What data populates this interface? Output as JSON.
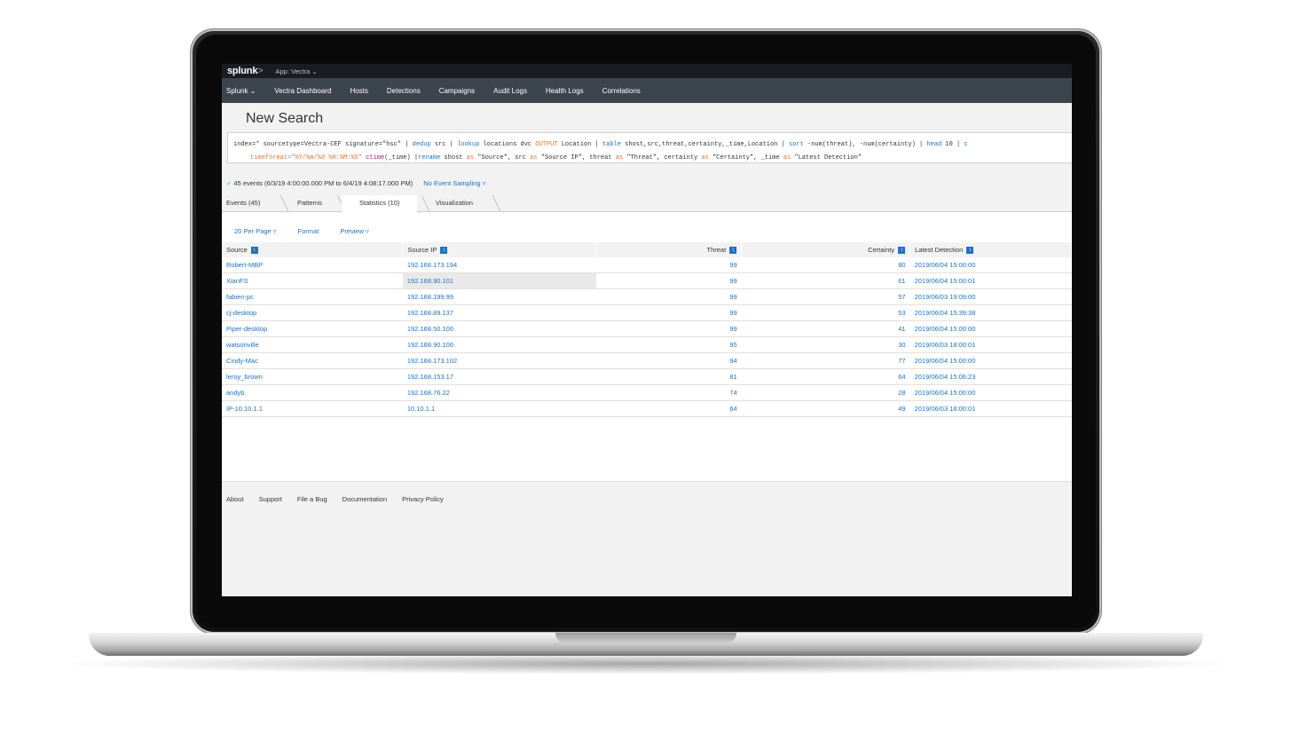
{
  "app": {
    "logo": "splunk",
    "logo_suffix": ">",
    "app_name": "App: Vectra ⌄"
  },
  "nav": {
    "items": [
      "Splunk ⌄",
      "Vectra Dashboard",
      "Hosts",
      "Detections",
      "Campaigns",
      "Audit Logs",
      "Health Logs",
      "Correlations"
    ]
  },
  "search": {
    "title": "New Search",
    "q1_a": "index=* sourcetype=Vectra-CEF signature=\"hsc\"  | ",
    "q1_dedup": "dedup",
    "q1_b": " src | ",
    "q1_lookup": "lookup",
    "q1_c": " locations dvc ",
    "q1_output": "OUTPUT",
    "q1_d": " Location | ",
    "q1_table": "table",
    "q1_e": " shost,src,threat,certainty,_time,Location | ",
    "q1_sort": "sort",
    "q1_f": " -num(threat), -num(certainty) | ",
    "q1_head": "head",
    "q1_g": " 10 | ",
    "q1_cut": "c",
    "q2_a": "timeformat=\"%Y/%m/%d %H:%M:%S\" ",
    "q2_ctime": "ctime",
    "q2_b": "(_time) |",
    "q2_rename": "rename",
    "q2_c": " shost ",
    "q2_as1": "as",
    "q2_d": " \"Source\", src ",
    "q2_as2": "as",
    "q2_e": " \"Source IP\", threat ",
    "q2_as3": "as",
    "q2_f": " \"Threat\", certainty ",
    "q2_as4": "as",
    "q2_g": " \"Certainty\", _time ",
    "q2_as5": "as",
    "q2_h": " \"Latest Detection\""
  },
  "status": {
    "check": "✓",
    "events": "45 events (6/3/19 4:00:00.000 PM to 6/4/19 4:08:17.000 PM)",
    "sampling": "No Event Sampling ▿"
  },
  "tabs": [
    "Events (45)",
    "Patterns",
    "Statistics (10)",
    "Visualization"
  ],
  "toolbar": {
    "per_page": "20 Per Page ▿",
    "format": "Format",
    "preview": "Preview ▿"
  },
  "table": {
    "headers": [
      "Source",
      "Source IP",
      "Threat",
      "Certainty",
      "Latest Detection"
    ],
    "sort_icon": "↕",
    "rows": [
      [
        "Robert-MBP",
        "192.168.173.194",
        "99",
        "80",
        "2019/06/04 15:00:00"
      ],
      [
        "XianFS",
        "192.168.90.101",
        "99",
        "61",
        "2019/06/04 15:00:01"
      ],
      [
        "fabien-pc",
        "192.168.199.99",
        "99",
        "57",
        "2019/06/03 19:09:00"
      ],
      [
        "cj-desktop",
        "192.168.89.137",
        "99",
        "53",
        "2019/06/04 15:39:38"
      ],
      [
        "Piper-desktop",
        "192.168.50.100",
        "99",
        "41",
        "2019/06/04 15:00:00"
      ],
      [
        "watsonville",
        "192.168.90.100",
        "95",
        "30",
        "2019/06/03 18:00:01"
      ],
      [
        "Cindy-Mac",
        "192.168.173.102",
        "94",
        "77",
        "2019/06/04 15:00:00"
      ],
      [
        "leroy_brown",
        "192.168.153.17",
        "81",
        "64",
        "2019/06/04 15:06:23"
      ],
      [
        "andyb",
        "192.168.76.22",
        "74",
        "28",
        "2019/06/04 15:00:00"
      ],
      [
        "IP-10.10.1.1",
        "10.10.1.1",
        "64",
        "49",
        "2019/06/03 18:00:01"
      ]
    ]
  },
  "footer": {
    "links": [
      "About",
      "Support",
      "File a Bug",
      "Documentation",
      "Privacy Policy"
    ]
  }
}
